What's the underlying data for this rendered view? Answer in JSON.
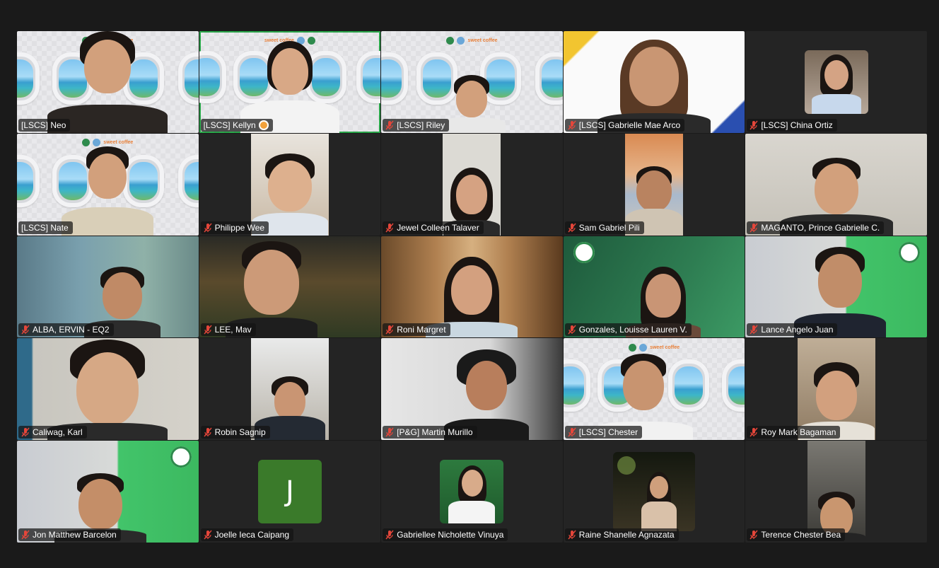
{
  "meeting": {
    "participants": [
      {
        "name": "[LSCS] Neo",
        "muted": false
      },
      {
        "name": "[LSCS] Kellyn",
        "muted": false,
        "active_speaker": true
      },
      {
        "name": "[LSCS] Riley",
        "muted": true
      },
      {
        "name": "[LSCS] Gabrielle Mae Arco",
        "muted": true
      },
      {
        "name": "[LSCS] China Ortiz",
        "muted": true
      },
      {
        "name": "[LSCS] Nate",
        "muted": false
      },
      {
        "name": "Philippe Wee",
        "muted": true
      },
      {
        "name": "Jewel Colleen Talaver",
        "muted": true
      },
      {
        "name": "Sam Gabriel Pili",
        "muted": true
      },
      {
        "name": "MAGANTO, Prince Gabrielle C.",
        "muted": true
      },
      {
        "name": "ALBA, ERVIN - EQ2",
        "muted": true
      },
      {
        "name": "LEE, Mav",
        "muted": true
      },
      {
        "name": "Roni Margret",
        "muted": true
      },
      {
        "name": "Gonzales, Louisse Lauren V.",
        "muted": true
      },
      {
        "name": "Lance Angelo Juan",
        "muted": true
      },
      {
        "name": "Caliwag, Karl",
        "muted": true
      },
      {
        "name": "Robin Sagnip",
        "muted": true
      },
      {
        "name": "[P&G] Martin Murillo",
        "muted": true
      },
      {
        "name": "[LSCS] Chester",
        "muted": true
      },
      {
        "name": "Roy Mark Bagaman",
        "muted": true
      },
      {
        "name": "Jon Matthew Barcelon",
        "muted": true
      },
      {
        "name": "Joelle Ieca Caipang",
        "muted": true,
        "initial": "J"
      },
      {
        "name": "Gabriellee Nicholette Vinuya",
        "muted": true
      },
      {
        "name": "Raine Shanelle Agnazata",
        "muted": true
      },
      {
        "name": "Terence Chester Bea",
        "muted": true
      }
    ],
    "colors": {
      "active_border": "#2aa84a",
      "muted_icon": "#e5463a",
      "initial_avatar": "#3a7a2a"
    }
  }
}
